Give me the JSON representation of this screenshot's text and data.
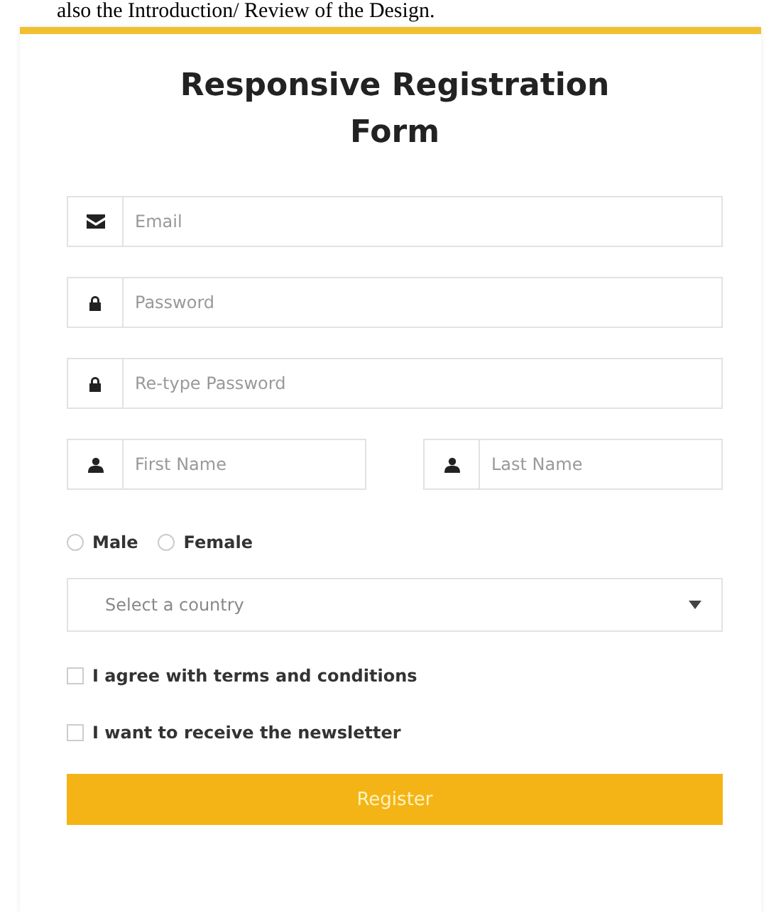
{
  "caption": "also the Introduction/ Review of the Design.",
  "form": {
    "title": "Responsive Registration Form",
    "fields": [
      {
        "kind": "email",
        "placeholder": "Email"
      },
      {
        "kind": "password",
        "placeholder": "Password"
      },
      {
        "kind": "password",
        "placeholder": "Re-type Password"
      }
    ],
    "name_fields": [
      {
        "kind": "user",
        "placeholder": "First Name"
      },
      {
        "kind": "user",
        "placeholder": "Last Name"
      }
    ],
    "gender": [
      {
        "label": "Male",
        "selected": false
      },
      {
        "label": "Female",
        "selected": false
      }
    ],
    "country": {
      "placeholder": "Select a country"
    },
    "checkboxes": [
      {
        "label": "I agree with terms and conditions",
        "checked": false
      },
      {
        "label": "I want to receive the newsletter",
        "checked": false
      }
    ],
    "button": "Register"
  }
}
